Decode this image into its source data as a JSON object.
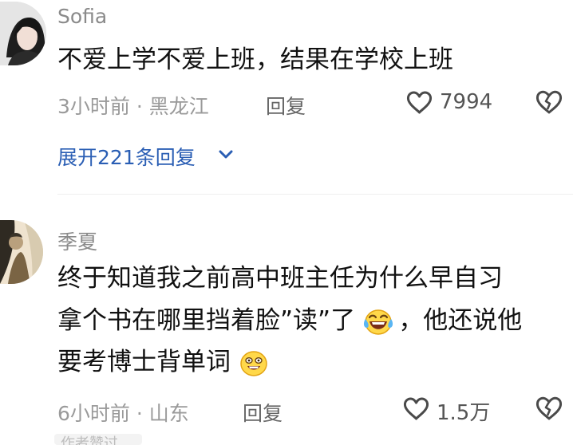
{
  "comments": [
    {
      "name": "Sofia",
      "text_lines": [
        "不爱上学不爱上班，结果在学校上班"
      ],
      "meta": "3小时前 · 黑龙江",
      "reply_label": "回复",
      "likes": "7994",
      "expand_label": "展开221条回复"
    },
    {
      "name": "季夏",
      "text_lines": [
        "终于知道我之前高中班主任为什么早自习",
        "拿个书在哪里挡着脸”读”了",
        "，他还说他",
        "要考博士背单词"
      ],
      "meta": "6小时前 · 山东",
      "reply_label": "回复",
      "likes": "1.5万"
    }
  ],
  "partial_next": "作者赞过",
  "icons": [
    "heart-icon",
    "dislike-heart-icon",
    "chevron-down-icon",
    "crying-laughing-emoji",
    "grinning-emoji"
  ]
}
